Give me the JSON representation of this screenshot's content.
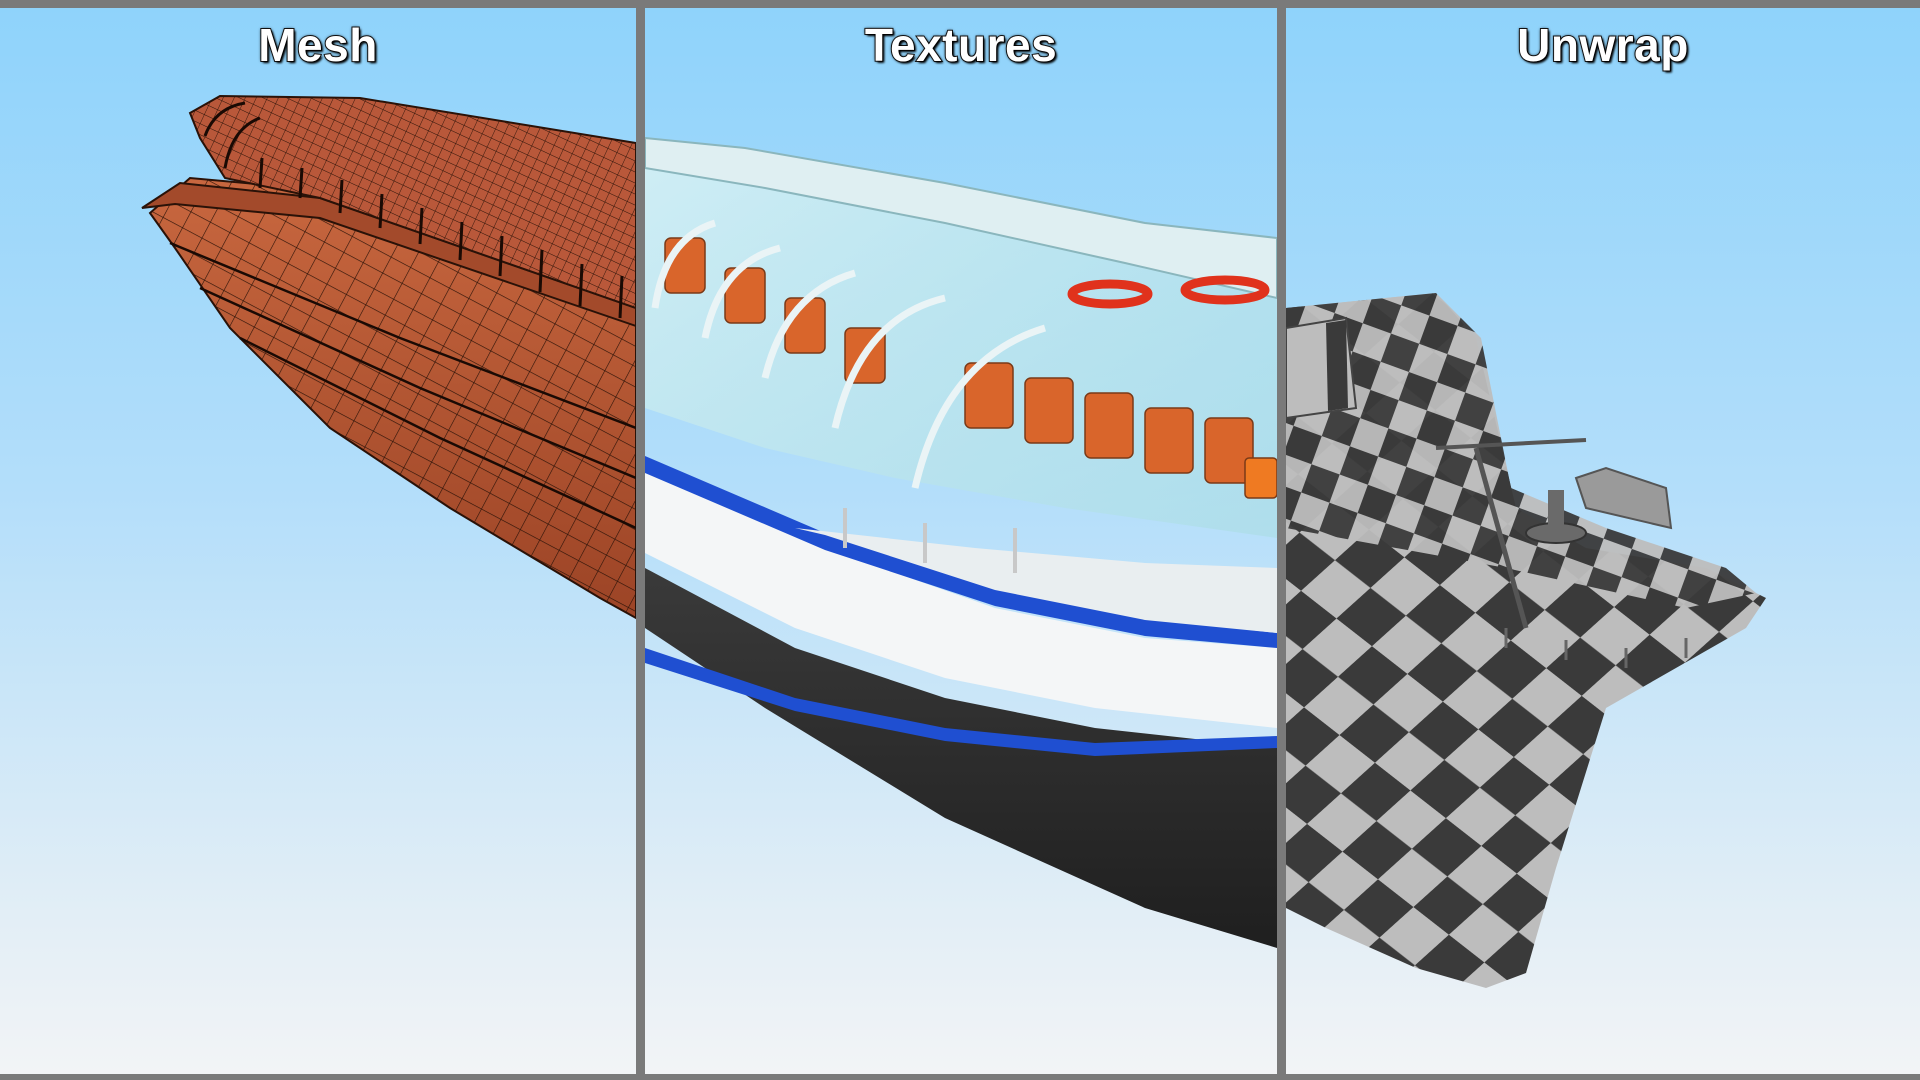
{
  "panels": [
    {
      "id": "mesh",
      "title": "Mesh"
    },
    {
      "id": "textures",
      "title": "Textures"
    },
    {
      "id": "unwrap",
      "title": "Unwrap"
    }
  ],
  "colors": {
    "frame": "#7a7a7a",
    "sky_top": "#8fd3fb",
    "sky_bottom": "#f2f4f6",
    "mesh_hull": "#b9583a",
    "mesh_wire": "#2a1208",
    "hull_dark": "#2b2b2b",
    "hull_white": "#f4f6f7",
    "stripe_blue": "#1f4fd1",
    "seats_orange": "#d9652b",
    "lifebuoy_red": "#e0321c",
    "checker_dark": "#3a3a3a",
    "checker_light": "#bdbdbd"
  }
}
